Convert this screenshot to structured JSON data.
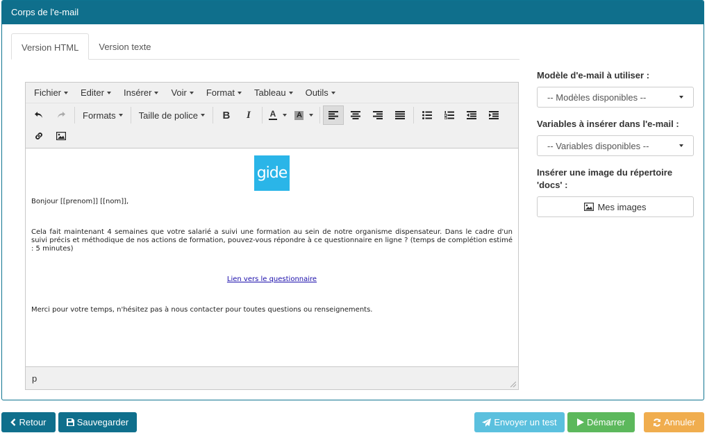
{
  "panel": {
    "title": "Corps de l'e-mail"
  },
  "tabs": [
    {
      "label": "Version HTML",
      "active": true
    },
    {
      "label": "Version texte",
      "active": false
    }
  ],
  "editor": {
    "menus": [
      "Fichier",
      "Editer",
      "Insérer",
      "Voir",
      "Format",
      "Tableau",
      "Outils"
    ],
    "toolbar": {
      "formats_label": "Formats",
      "font_size_label": "Taille de police",
      "bold_label": "B",
      "italic_label": "I",
      "text_color_label": "A",
      "bg_color_label": "A"
    },
    "content": {
      "logo_text": "gide",
      "greeting": "Bonjour [[prenom]] [[nom]],",
      "body": "Cela fait maintenant 4 semaines que votre salarié a suivi une formation au sein de notre organisme dispensateur. Dans le cadre d'un suivi précis et méthodique de nos actions de formation, pouvez-vous répondre à ce questionnaire en ligne ? (temps de complétion estimé : 5 minutes)",
      "link": "Lien vers le questionnaire",
      "closing": "Merci pour votre temps, n'hésitez pas à nous contacter pour toutes questions ou renseignements."
    },
    "statusbar_path": "p"
  },
  "sidebar": {
    "template_label": "Modèle d'e-mail à utiliser :",
    "template_select": "-- Modèles disponibles --",
    "variables_label": "Variables à insérer dans l'e-mail :",
    "variables_select": "-- Variables disponibles --",
    "image_label": "Insérer une image du répertoire 'docs' :",
    "image_button": "Mes images"
  },
  "footer": {
    "back": "Retour",
    "save": "Sauvegarder",
    "send_test": "Envoyer un test",
    "start": "Démarrer",
    "cancel": "Annuler"
  },
  "colors": {
    "header": "#0f6f8c",
    "dark_btn": "#0f6f8c",
    "send_test": "#5bc0de",
    "start": "#5cb85c",
    "cancel": "#f0ad4e",
    "logo": "#2ab5e8"
  }
}
